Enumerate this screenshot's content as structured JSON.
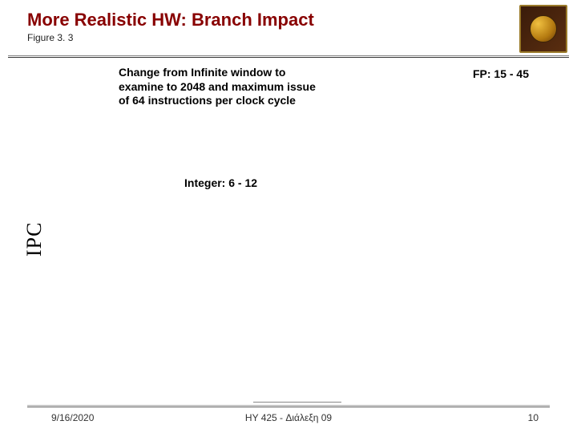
{
  "header": {
    "title": "More Realistic HW: Branch Impact",
    "figure_label": "Figure 3. 3"
  },
  "notes": {
    "change": "Change from Infinite window to examine to 2048 and maximum issue of 64 instructions per clock cycle",
    "fp": "FP: 15 - 45",
    "integer": "Integer: 6 - 12"
  },
  "axis": {
    "y_label": "IPC"
  },
  "footer": {
    "date": "9/16/2020",
    "center": "HY 425 - Διάλεξη 09",
    "page": "10"
  }
}
